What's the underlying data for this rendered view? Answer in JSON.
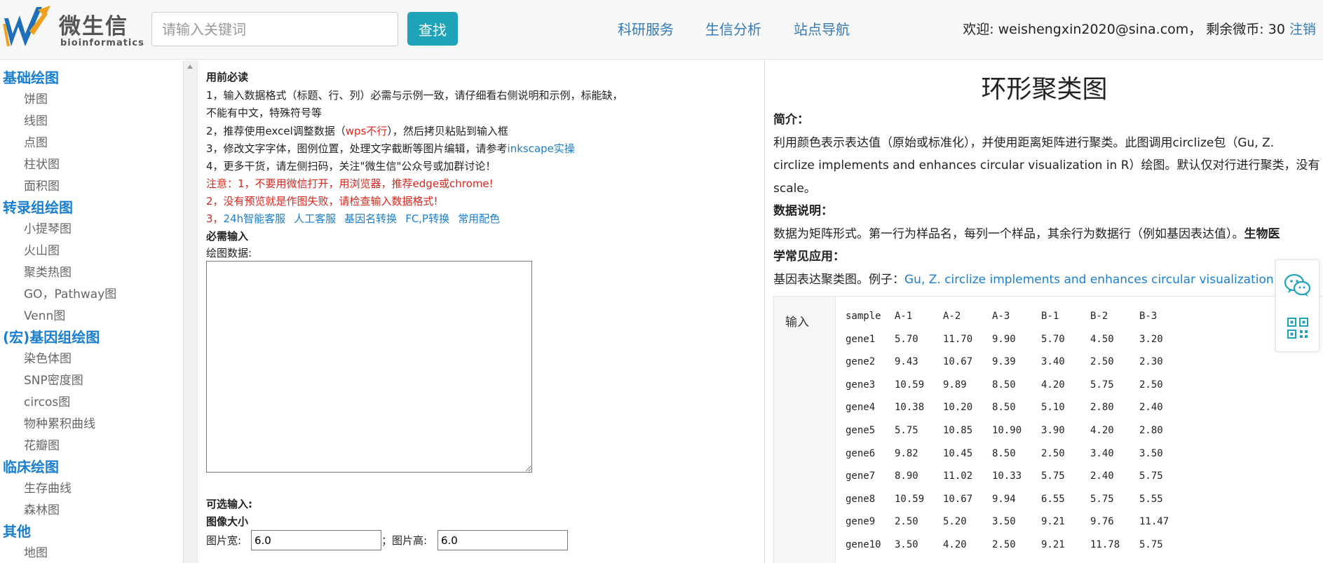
{
  "header": {
    "logo_text": "微生信",
    "logo_sub": "bioinformatics",
    "search_placeholder": "请输入关键词",
    "search_button": "查找",
    "nav": [
      "科研服务",
      "生信分析",
      "站点导航"
    ],
    "welcome_prefix": "欢迎: weishengxin2020@sina.com， 剩余微币: 30",
    "logout": "注销"
  },
  "sidebar": {
    "categories": [
      {
        "title": "基础绘图",
        "items": [
          "饼图",
          "线图",
          "点图",
          "柱状图",
          "面积图"
        ]
      },
      {
        "title": "转录组绘图",
        "items": [
          "小提琴图",
          "火山图",
          "聚类热图",
          "GO，Pathway图",
          "Venn图"
        ]
      },
      {
        "title": "(宏)基因组绘图",
        "items": [
          "染色体图",
          "SNP密度图",
          "circos图",
          "物种累积曲线",
          "花瓣图"
        ]
      },
      {
        "title": "临床绘图",
        "items": [
          "生存曲线",
          "森林图"
        ]
      },
      {
        "title": "其他",
        "items": [
          "地图"
        ]
      }
    ]
  },
  "form": {
    "notice_title": "用前必读",
    "rule1a": "1，输入数据格式（标题、行、列）必需与示例一致，请仔细看右侧说明和示例，标能缺，",
    "rule1b": "不能有中文，特殊符号等",
    "rule2_pre": "2，推荐使用excel调整数据（",
    "rule2_red": "wps不行",
    "rule2_post": "），然后拷贝粘贴到输入框",
    "rule3_pre": "3，修改文字字体，图例位置，处理文字截断等图片编辑，请参考",
    "rule3_link": "inkscape实操",
    "rule4": "4，更多干货，请左侧扫码，关注\"微生信\"公众号或加群讨论！",
    "warn1": "注意：1，不要用微信打开，用浏览器，推荐edge或chrome!",
    "warn2": "2，没有预览就是作图失败，请检查输入数据格式!",
    "links_prefix": "3，",
    "links": [
      "24h智能客服",
      "人工客服",
      "基因名转换",
      "FC,P转换",
      "常用配色"
    ],
    "required_title": "必需输入",
    "data_label": "绘图数据:",
    "optional_title": "可选输入:",
    "size_title": "图像大小",
    "width_label": "图片宽:",
    "width_value": "6.0",
    "height_label": "；图片高:",
    "height_value": "6.0"
  },
  "panel": {
    "title": "环形聚类图",
    "intro_head": "简介：",
    "intro_l1": "利用颜色表示表达值（原始或标准化），并使用距离矩阵进行聚类。此图调用circlize包（Gu, Z.",
    "intro_l2": "circlize implements and enhances circular visualization in R）绘图。默认仅对行进行聚类，没有",
    "intro_l3": "scale。",
    "data_head": "数据说明：",
    "data_text": "数据为矩阵形式。第一行为样品名，每列一个样品，其余行为数据行（例如基因表达值）。",
    "bio_head_a": "生物医",
    "bio_head_b": "学常见应用：",
    "app_text": "基因表达聚类图。例子：",
    "app_link": "Gu, Z. circlize implements and enhances circular visualization in R",
    "example_label": "输入",
    "example_header": [
      "sample",
      "A-1",
      "A-2",
      "A-3",
      "B-1",
      "B-2",
      "B-3"
    ],
    "example_rows": [
      [
        "gene1",
        "5.70",
        "11.70",
        "9.90",
        "5.70",
        "4.50",
        "3.20"
      ],
      [
        "gene2",
        "9.43",
        "10.67",
        "9.39",
        "3.40",
        "2.50",
        "2.30"
      ],
      [
        "gene3",
        "10.59",
        "9.89",
        "8.50",
        "4.20",
        "5.75",
        "2.50"
      ],
      [
        "gene4",
        "10.38",
        "10.20",
        "8.50",
        "5.10",
        "2.80",
        "2.40"
      ],
      [
        "gene5",
        "5.75",
        "10.85",
        "10.90",
        "3.90",
        "4.20",
        "2.80"
      ],
      [
        "gene6",
        "9.82",
        "10.45",
        "8.50",
        "2.50",
        "3.40",
        "3.50"
      ],
      [
        "gene7",
        "8.90",
        "11.02",
        "10.33",
        "5.75",
        "2.40",
        "5.75"
      ],
      [
        "gene8",
        "10.59",
        "10.67",
        "9.94",
        "6.55",
        "5.75",
        "5.55"
      ],
      [
        "gene9",
        "2.50",
        "5.20",
        "3.50",
        "9.21",
        "9.76",
        "11.47"
      ],
      [
        "gene10",
        "3.50",
        "4.20",
        "2.50",
        "9.21",
        "11.78",
        "5.75"
      ]
    ]
  },
  "colors": {
    "accent": "#1fa3b8",
    "link": "#1a7fd0",
    "warning": "#d9261c"
  }
}
